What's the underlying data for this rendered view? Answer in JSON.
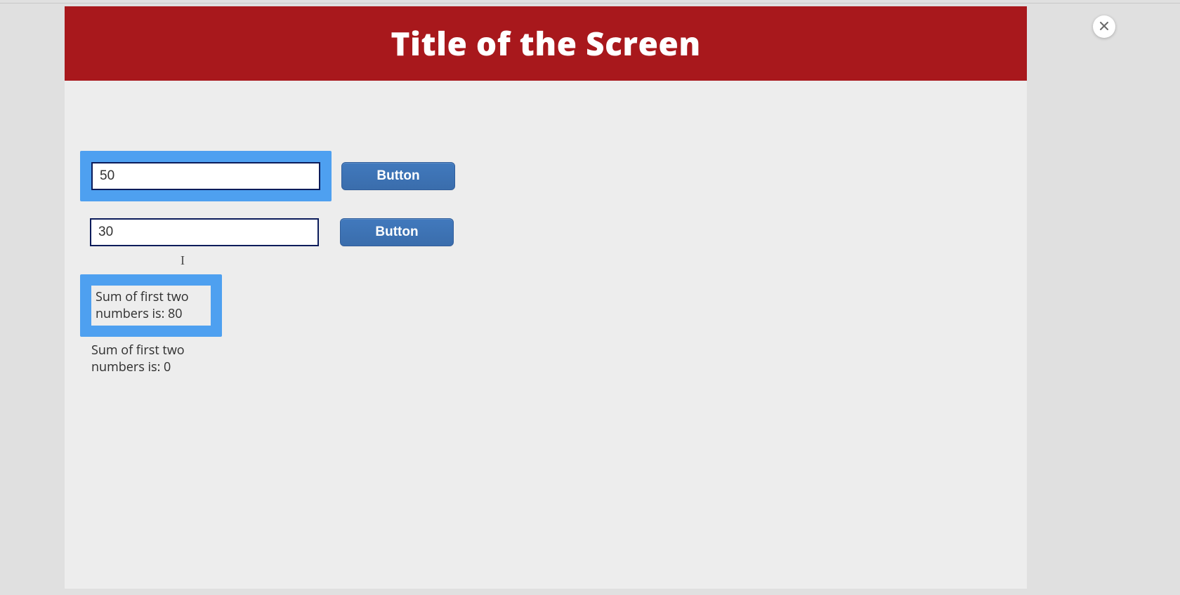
{
  "header": {
    "title": "Title of the Screen"
  },
  "inputs": {
    "first": {
      "value": "50"
    },
    "second": {
      "value": "30"
    }
  },
  "buttons": {
    "first_label": "Button",
    "second_label": "Button"
  },
  "results": {
    "highlighted": "Sum of first two numbers is: 80",
    "plain": "Sum of first two numbers is: 0"
  },
  "close": {
    "aria": "Close"
  }
}
